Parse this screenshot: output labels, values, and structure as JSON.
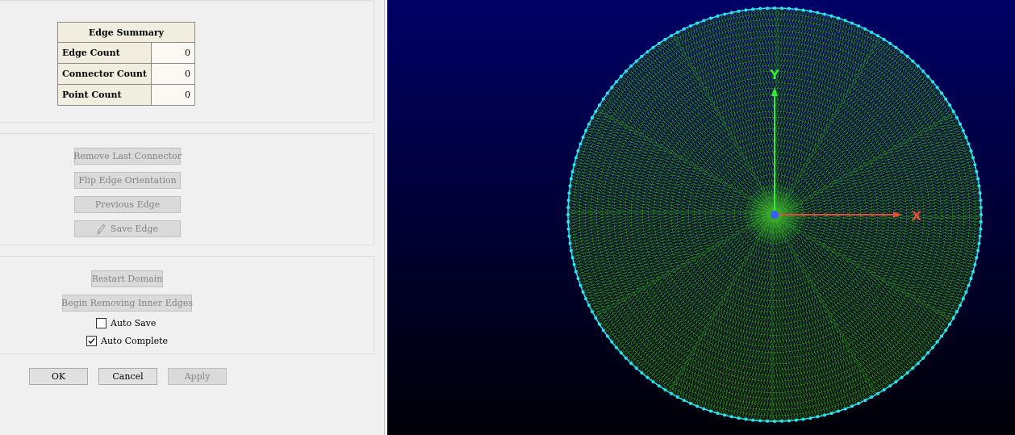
{
  "edge_summary": {
    "title": "Edge Summary",
    "rows": [
      {
        "label": "Edge Count",
        "value": "0"
      },
      {
        "label": "Connector Count",
        "value": "0"
      },
      {
        "label": "Point Count",
        "value": "0"
      }
    ]
  },
  "edge_actions": {
    "remove_last_connector": "Remove Last Connector",
    "flip_edge_orientation": "Flip Edge Orientation",
    "previous_edge": "Previous Edge",
    "save_edge": "Save Edge"
  },
  "domain_actions": {
    "restart_domain": "Restart Domain",
    "begin_removing_inner_edges": "Begin Removing Inner Edges",
    "auto_save": {
      "label": "Auto Save",
      "checked": false
    },
    "auto_complete": {
      "label": "Auto Complete",
      "checked": true
    }
  },
  "dialog_buttons": {
    "ok": "OK",
    "cancel": "Cancel",
    "apply": "Apply"
  },
  "viewport": {
    "axis_y_label": "Y",
    "axis_x_label": "X",
    "colors": {
      "mesh": "#2f8f1a",
      "boundary": "#27e6f2",
      "axis_y": "#33ee33",
      "axis_x": "#e84a3a",
      "origin": "#3a5cff"
    }
  }
}
